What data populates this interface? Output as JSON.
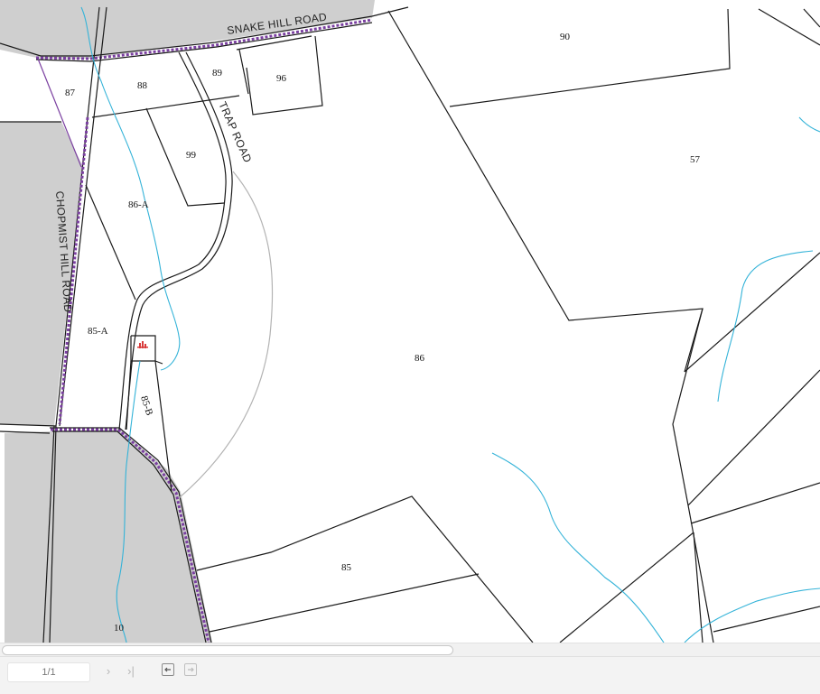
{
  "map": {
    "roads": {
      "snake_hill": "SNAKE HILL ROAD",
      "trap": "TRAP ROAD",
      "chopmist_hill": "CHOPMIST HILL ROAD"
    },
    "lots": {
      "lot_90": "90",
      "lot_57": "57",
      "lot_87": "87",
      "lot_88": "88",
      "lot_89": "89",
      "lot_96": "96",
      "lot_99": "99",
      "lot_86a": "86-A",
      "lot_85a": "85-A",
      "lot_85b": "85-B",
      "lot_86": "86",
      "lot_85": "85",
      "lot_10": "10"
    },
    "colors": {
      "parcel_line": "#1a1a1a",
      "stream": "#34b3d8",
      "row_fill": "#d0d0d0",
      "boundary_dash": "#7a3fa0",
      "trail": "#b3b3b3",
      "building_marker": "#d83a3a"
    }
  },
  "viewer": {
    "page_indicator": "1/1",
    "next_page_icon": "chevron-right-icon",
    "last_page_icon": "skip-last-icon",
    "back_icon": "back-arrow-icon",
    "forward_icon": "forward-arrow-icon"
  }
}
